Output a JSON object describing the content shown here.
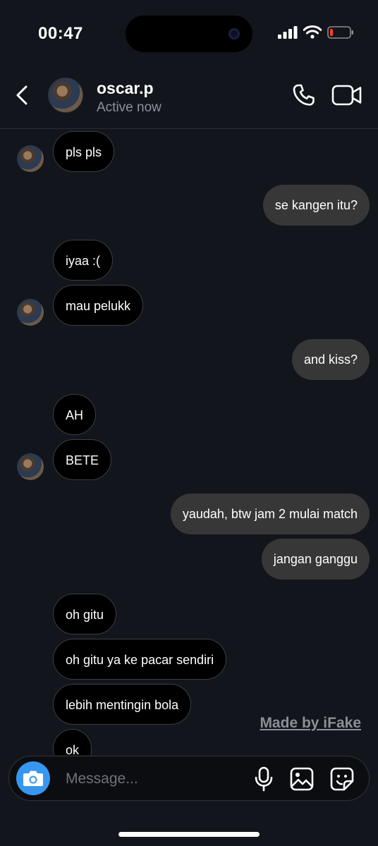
{
  "status_bar": {
    "time": "00:47"
  },
  "header": {
    "username": "oscar.p",
    "presence": "Active now"
  },
  "messages": [
    {
      "from": "them",
      "text": "pls pls"
    },
    {
      "from": "me",
      "text": "se kangen itu?"
    },
    {
      "from": "them",
      "text": "iyaa :("
    },
    {
      "from": "them",
      "text": "mau pelukk"
    },
    {
      "from": "me",
      "text": "and kiss?"
    },
    {
      "from": "them",
      "text": "AH"
    },
    {
      "from": "them",
      "text": "BETE"
    },
    {
      "from": "me",
      "text": "yaudah, btw jam 2 mulai match"
    },
    {
      "from": "me",
      "text": "jangan ganggu"
    },
    {
      "from": "them",
      "text": "oh gitu"
    },
    {
      "from": "them",
      "text": "oh gitu ya ke pacar sendiri"
    },
    {
      "from": "them",
      "text": "lebih mentingin bola"
    },
    {
      "from": "them",
      "text": "ok"
    }
  ],
  "watermark": "Made by iFake",
  "composer": {
    "placeholder": "Message..."
  },
  "colors": {
    "background": "#12151b",
    "outgoing_bubble": "#373737",
    "incoming_bubble": "#000000",
    "camera_button": "#3797f0"
  },
  "icons": [
    "back-chevron",
    "phone",
    "video-camera",
    "camera",
    "microphone",
    "gallery",
    "sticker",
    "signal",
    "wifi",
    "battery-low"
  ]
}
